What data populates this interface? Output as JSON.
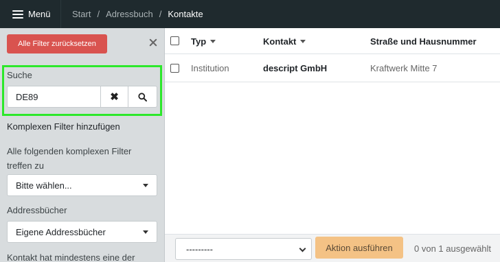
{
  "topbar": {
    "menu_label": "Menü",
    "breadcrumb": {
      "start": "Start",
      "addressbook": "Adressbuch",
      "current": "Kontakte",
      "separator": "/"
    }
  },
  "sidebar": {
    "reset_filters_label": "Alle Filter zurücksetzen",
    "search": {
      "label": "Suche",
      "value": "DE89"
    },
    "add_complex_filter_label": "Komplexen Filter hinzufügen",
    "complex_filter_match": {
      "label": "Alle folgenden komplexen Filter treffen zu",
      "selected": "Bitte wählen..."
    },
    "addressbooks": {
      "label": "Addressbücher",
      "selected": "Eigene Addressbücher"
    },
    "contact_has_label": "Kontakt hat mindestens eine der"
  },
  "table": {
    "columns": {
      "type": "Typ",
      "contact": "Kontakt",
      "street": "Straße und Hausnummer"
    },
    "rows": [
      {
        "type": "Institution",
        "contact": "descript GmbH",
        "street": "Kraftwerk Mitte 7"
      }
    ]
  },
  "actionbar": {
    "select_value": "---------",
    "run_label": "Aktion ausführen",
    "selection_count": "0 von 1 ausgewählt"
  },
  "colors": {
    "topbar_bg": "#1f2a2e",
    "sidebar_bg": "#d8dcde",
    "reset_button": "#d9534f",
    "search_highlight": "#2ce82a",
    "action_button": "#f4c285"
  }
}
